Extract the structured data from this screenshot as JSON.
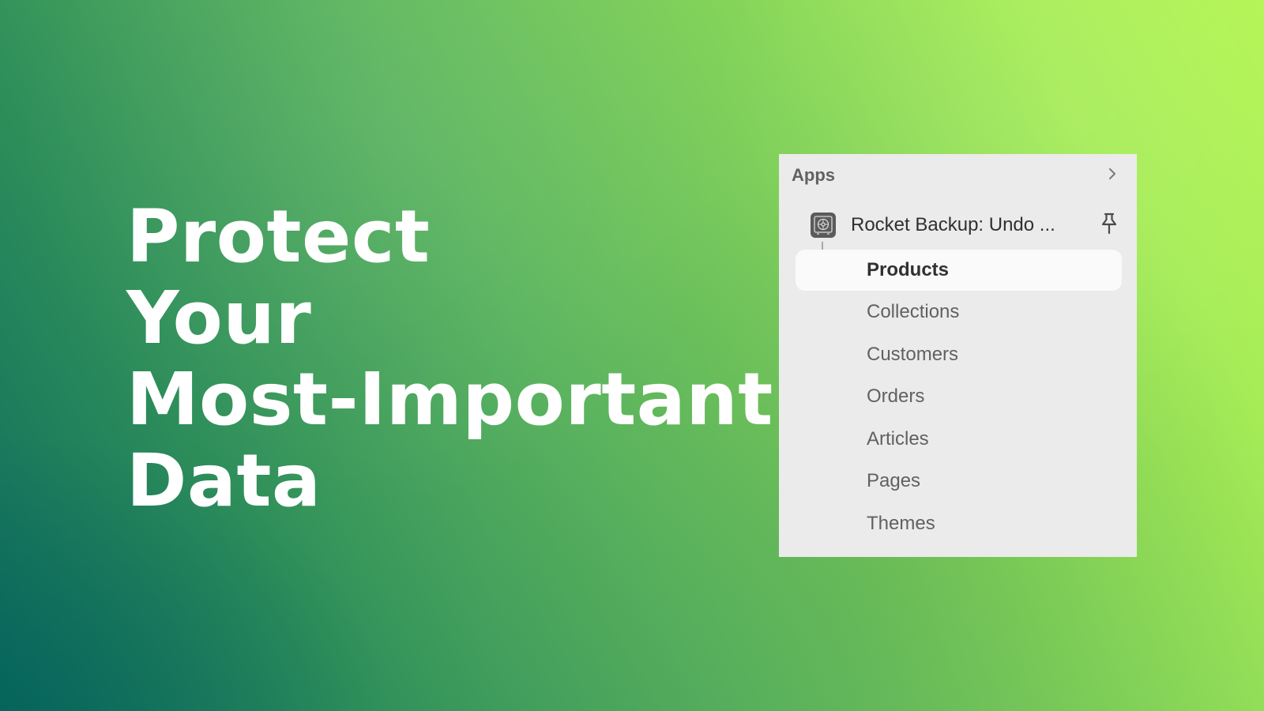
{
  "headline": {
    "lines": [
      "Protect",
      "Your",
      "Most-Important",
      "Data"
    ]
  },
  "panel": {
    "title": "Apps",
    "expand_icon": "chevron-right-icon",
    "app": {
      "name": "Rocket Backup: Undo ...",
      "icon": "vault-icon",
      "pin_icon": "pin-icon"
    },
    "nav_items": [
      {
        "label": "Products",
        "active": true
      },
      {
        "label": "Collections",
        "active": false
      },
      {
        "label": "Customers",
        "active": false
      },
      {
        "label": "Orders",
        "active": false
      },
      {
        "label": "Articles",
        "active": false
      },
      {
        "label": "Pages",
        "active": false
      },
      {
        "label": "Themes",
        "active": false
      }
    ]
  },
  "colors": {
    "gradient_start": "#0c6b5e",
    "gradient_end": "#b3f552",
    "panel_bg": "#ebebeb",
    "active_item_bg": "#fafafa"
  }
}
